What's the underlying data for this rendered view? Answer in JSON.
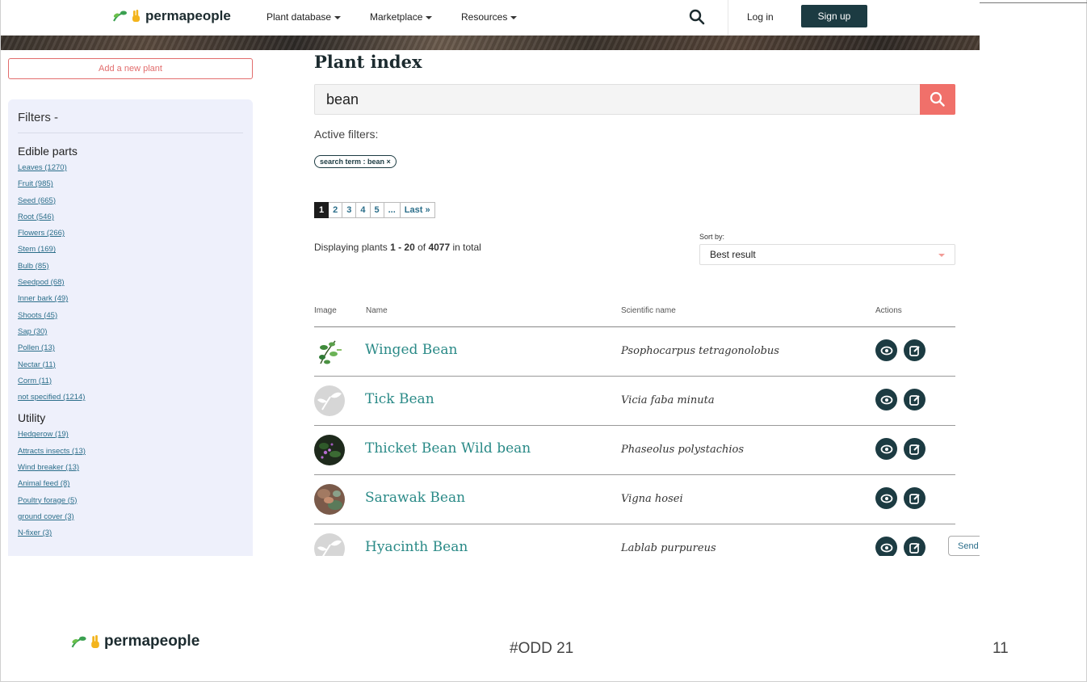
{
  "header": {
    "brand": "permapeople",
    "nav": [
      {
        "label": "Plant database"
      },
      {
        "label": "Marketplace"
      },
      {
        "label": "Resources"
      }
    ],
    "login": "Log in",
    "signup": "Sign up"
  },
  "sidebar": {
    "add_plant": "Add a new plant",
    "filters_title": "Filters -",
    "edible_title": "Edible parts",
    "edible": [
      "Leaves (1270)",
      "Fruit (985)",
      "Seed (665)",
      "Root (546)",
      "Flowers (266)",
      "Stem (169)",
      "Bulb (85)",
      "Seedpod (68)",
      "Inner bark (49)",
      "Shoots (45)",
      "Sap (30)",
      "Pollen (13)",
      "Nectar (11)",
      "Corm (11)",
      "not specified (1214)"
    ],
    "utility_title": "Utility",
    "utility": [
      "Hedgerow (19)",
      "Attracts insects (13)",
      "Wind breaker (13)",
      "Animal feed (8)",
      "Poultry forage (5)",
      "ground cover (3)",
      "N-fixer (3)"
    ]
  },
  "main": {
    "title": "Plant index",
    "search_value": "bean",
    "active_filters_label": "Active filters:",
    "chip": "search term : bean ×",
    "pages": [
      "1",
      "2",
      "3",
      "4",
      "5",
      "...",
      "Last »"
    ],
    "current_page": "1",
    "displaying_prefix": "Displaying plants ",
    "displaying_range": "1 - 20",
    "displaying_of": " of ",
    "displaying_total": "4077",
    "displaying_suffix": " in total",
    "sort_label": "Sort by:",
    "sort_value": "Best result",
    "columns": {
      "image": "Image",
      "name": "Name",
      "scientific": "Scientific name",
      "actions": "Actions"
    },
    "rows": [
      {
        "name": "Winged Bean",
        "scientific": "Psophocarpus tetragonolobus",
        "thumb": "plant-photo"
      },
      {
        "name": "Tick Bean",
        "scientific": "Vicia faba minuta",
        "thumb": "placeholder-sprout"
      },
      {
        "name": "Thicket Bean Wild bean",
        "scientific": "Phaseolus polystachios",
        "thumb": "plant-photo"
      },
      {
        "name": "Sarawak Bean",
        "scientific": "Vigna hosei",
        "thumb": "plant-photo"
      },
      {
        "name": "Hyacinth Bean",
        "scientific": "Lablab purpureus",
        "thumb": "placeholder-sprout"
      }
    ],
    "send_button": "Send"
  },
  "footer": {
    "brand": "permapeople",
    "tag": "#ODD 21",
    "page_number": "11"
  },
  "colors": {
    "accent": "#f0706a",
    "brand_dark": "#1c3b42",
    "link": "#2b6e8a",
    "plant_name": "#2a8a87",
    "sidebar_bg": "#eef0fb"
  }
}
